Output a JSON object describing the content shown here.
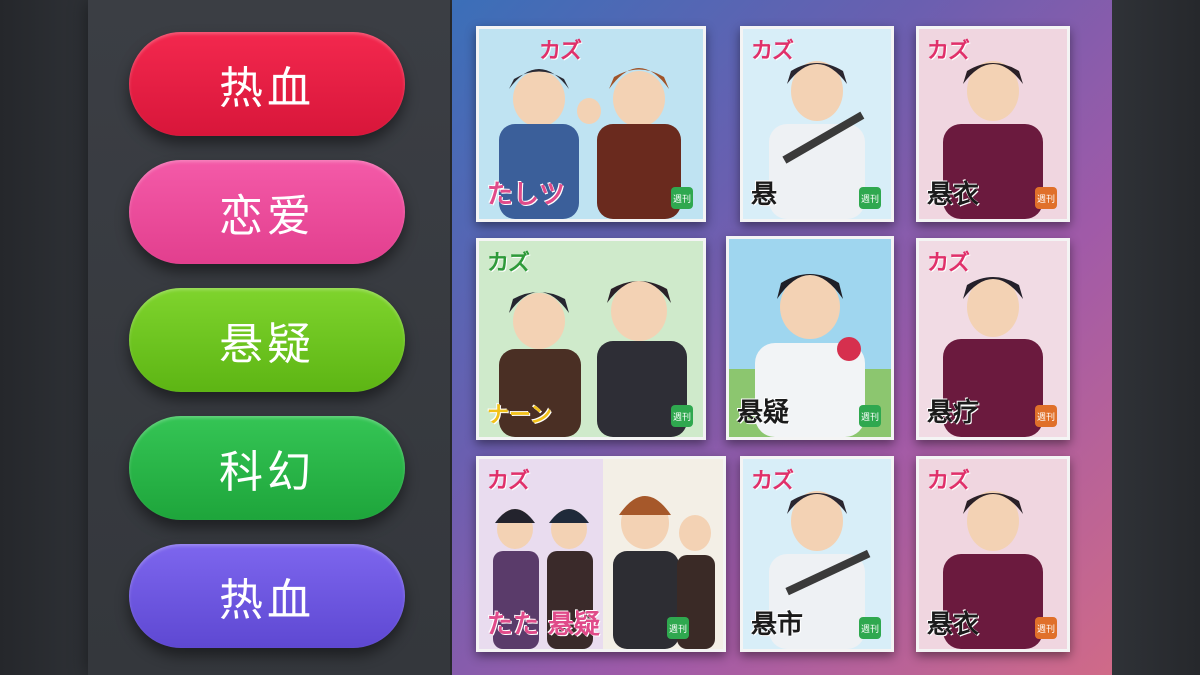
{
  "genres": [
    {
      "label": "热血",
      "color": "#e81f43"
    },
    {
      "label": "恋爱",
      "color": "#ef4d9c"
    },
    {
      "label": "悬疑",
      "color": "#6cc61f"
    },
    {
      "label": "科幻",
      "color": "#27b445"
    },
    {
      "label": "热血",
      "color": "#6f58e0"
    }
  ],
  "covers": [
    {
      "logo": "カズ",
      "title": "たしツ",
      "badge": "週刊"
    },
    {
      "logo": "カズ",
      "title": "悬",
      "badge": "週刊"
    },
    {
      "logo": "カズ",
      "title": "悬衣",
      "badge": "週刊"
    },
    {
      "logo": "カズ",
      "title": "ナーン",
      "badge": "週刊"
    },
    {
      "logo": "",
      "title": "悬疑",
      "badge": "週刊"
    },
    {
      "logo": "カズ",
      "title": "悬疗",
      "badge": "週刊"
    },
    {
      "logo": "カズ",
      "title": "たた 悬疑",
      "badge": "週刊"
    },
    {
      "logo": "カズ",
      "title": "悬市",
      "badge": "週刊"
    },
    {
      "logo": "カズ",
      "title": "悬衣",
      "badge": "週刊"
    }
  ]
}
